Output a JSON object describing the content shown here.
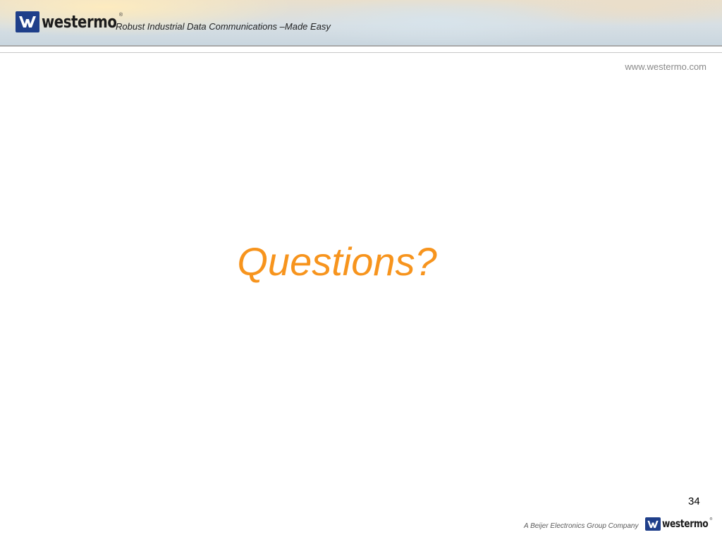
{
  "header": {
    "logo_text": "westermo",
    "logo_registered": "®",
    "tagline": "Robust Industrial Data Communications –Made Easy"
  },
  "url": "www.westermo.com",
  "main": {
    "title": "Questions?",
    "title_color": "#f7941d"
  },
  "footer": {
    "page_number": "34",
    "company": "A Beijer Electronics Group Company",
    "logo_text": "westermo",
    "logo_registered": "®"
  },
  "colors": {
    "brand_blue": "#1f3f8a",
    "accent_orange": "#f7941d"
  },
  "icons": {
    "logo_mark": "westermo-w-icon"
  }
}
